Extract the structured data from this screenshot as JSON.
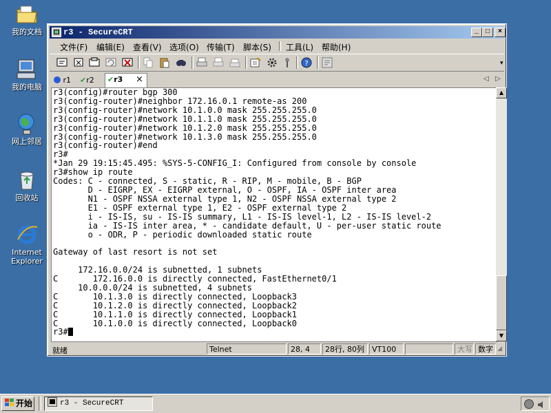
{
  "desktop": {
    "icons": [
      {
        "label": "我的文档",
        "icon": "my-documents-icon"
      },
      {
        "label": "我的电脑",
        "icon": "my-computer-icon"
      },
      {
        "label": "网上邻居",
        "icon": "network-places-icon"
      },
      {
        "label": "回收站",
        "icon": "recycle-bin-icon"
      },
      {
        "label": "Internet Explorer",
        "icon": "internet-explorer-icon"
      }
    ]
  },
  "window": {
    "title": "r3 - SecureCRT",
    "menu": [
      "文件(F)",
      "编辑(E)",
      "查看(V)",
      "选项(O)",
      "传输(T)",
      "脚本(S)",
      "工具(L)",
      "帮助(H)"
    ],
    "tabs": [
      {
        "label": "r1",
        "status": "info"
      },
      {
        "label": "r2",
        "status": "connected"
      },
      {
        "label": "r3",
        "status": "connected",
        "active": true
      }
    ],
    "tab_close": "×",
    "terminal_lines": [
      "r3(config)#router bgp 300",
      "r3(config-router)#neighbor 172.16.0.1 remote-as 200",
      "r3(config-router)#network 10.1.0.0 mask 255.255.255.0",
      "r3(config-router)#network 10.1.1.0 mask 255.255.255.0",
      "r3(config-router)#network 10.1.2.0 mask 255.255.255.0",
      "r3(config-router)#network 10.1.3.0 mask 255.255.255.0",
      "r3(config-router)#end",
      "r3#",
      "*Jan 29 19:15:45.495: %SYS-5-CONFIG_I: Configured from console by console",
      "r3#show ip route",
      "Codes: C - connected, S - static, R - RIP, M - mobile, B - BGP",
      "       D - EIGRP, EX - EIGRP external, O - OSPF, IA - OSPF inter area",
      "       N1 - OSPF NSSA external type 1, N2 - OSPF NSSA external type 2",
      "       E1 - OSPF external type 1, E2 - OSPF external type 2",
      "       i - IS-IS, su - IS-IS summary, L1 - IS-IS level-1, L2 - IS-IS level-2",
      "       ia - IS-IS inter area, * - candidate default, U - per-user static route",
      "       o - ODR, P - periodic downloaded static route",
      "",
      "Gateway of last resort is not set",
      "",
      "     172.16.0.0/24 is subnetted, 1 subnets",
      "C       172.16.0.0 is directly connected, FastEthernet0/1",
      "     10.0.0.0/24 is subnetted, 4 subnets",
      "C       10.1.3.0 is directly connected, Loopback3",
      "C       10.1.2.0 is directly connected, Loopback2",
      "C       10.1.1.0 is directly connected, Loopback1",
      "C       10.1.0.0 is directly connected, Loopback0",
      "r3#"
    ],
    "status": {
      "ready": "就绪",
      "protocol": "Telnet",
      "cursor_pos": "28, 4",
      "size": "28行, 80列",
      "emulation": "VT100",
      "caps": "大写",
      "num": "数字"
    }
  },
  "taskbar": {
    "start_label": "开始",
    "task_label": "r3 - SecureCRT"
  },
  "colors": {
    "desktop": "#3a6ea5",
    "title_active_start": "#0a246a",
    "title_active_end": "#a6caf0",
    "chrome": "#d4d0c8"
  }
}
